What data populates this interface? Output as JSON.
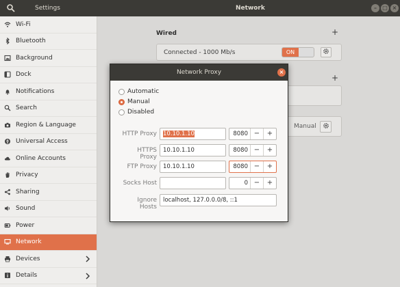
{
  "titlebar": {
    "app_title": "Settings",
    "page_title": "Network",
    "search_icon": "search-icon",
    "buttons": [
      "minimize-icon",
      "maximize-icon",
      "close-icon"
    ]
  },
  "sidebar": {
    "items": [
      {
        "label": "Wi-Fi",
        "icon": "wifi-icon"
      },
      {
        "label": "Bluetooth",
        "icon": "bluetooth-icon"
      },
      {
        "label": "Background",
        "icon": "background-icon"
      },
      {
        "label": "Dock",
        "icon": "dock-icon"
      },
      {
        "label": "Notifications",
        "icon": "bell-icon"
      },
      {
        "label": "Search",
        "icon": "search-icon"
      },
      {
        "label": "Region & Language",
        "icon": "camera-icon"
      },
      {
        "label": "Universal Access",
        "icon": "accessibility-icon"
      },
      {
        "label": "Online Accounts",
        "icon": "cloud-icon"
      },
      {
        "label": "Privacy",
        "icon": "hand-icon"
      },
      {
        "label": "Sharing",
        "icon": "share-icon"
      },
      {
        "label": "Sound",
        "icon": "speaker-icon"
      },
      {
        "label": "Power",
        "icon": "power-icon"
      },
      {
        "label": "Network",
        "icon": "network-icon",
        "active": true
      },
      {
        "label": "Devices",
        "icon": "printer-icon",
        "has_chevron": true
      },
      {
        "label": "Details",
        "icon": "info-icon",
        "has_chevron": true
      }
    ]
  },
  "main": {
    "wired": {
      "title": "Wired",
      "add_label": "+",
      "status": "Connected - 1000 Mb/s",
      "toggle_label": "ON"
    },
    "vpn": {
      "add_label": "+"
    },
    "proxy": {
      "value": "Manual"
    }
  },
  "dialog": {
    "title": "Network Proxy",
    "method_options": [
      "Automatic",
      "Manual",
      "Disabled"
    ],
    "selected_method": "Manual",
    "rows": [
      {
        "label": "HTTP Proxy",
        "host": "10.10.1.10",
        "port": "8080",
        "host_selected": true
      },
      {
        "label": "HTTPS Proxy",
        "host": "10.10.1.10",
        "port": "8080"
      },
      {
        "label": "FTP Proxy",
        "host": "10.10.1.10",
        "port": "8080",
        "port_focused": true
      },
      {
        "label": "Socks Host",
        "host": "",
        "port": "0"
      }
    ],
    "ignore_hosts": {
      "label": "Ignore Hosts",
      "value": "localhost, 127.0.0.0/8, ::1"
    },
    "spin_minus": "−",
    "spin_plus": "+"
  },
  "colors": {
    "accent": "#e0714a",
    "titlebar": "#3b3a36",
    "sidebar_bg": "#efeeec"
  }
}
